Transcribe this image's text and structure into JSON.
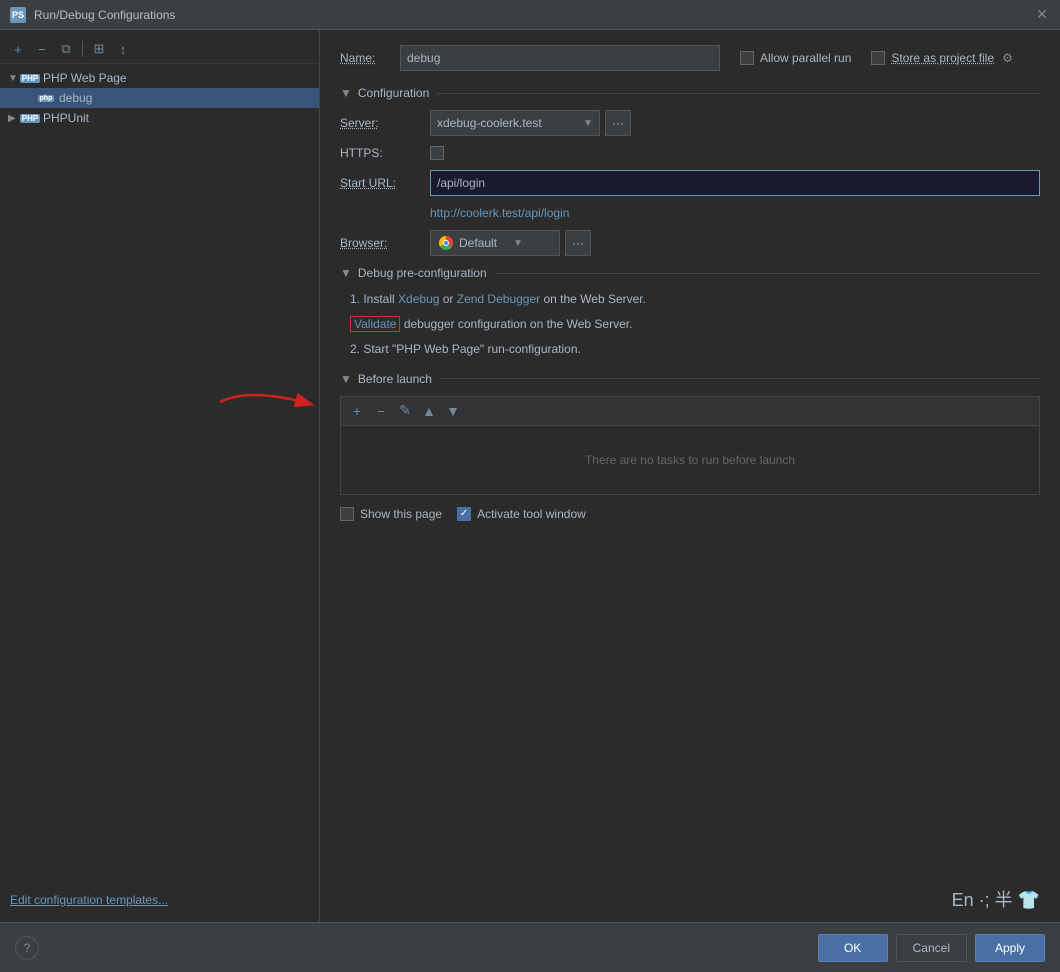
{
  "titleBar": {
    "title": "Run/Debug Configurations",
    "closeIcon": "✕"
  },
  "toolbar": {
    "addBtn": "+",
    "removeBtn": "−",
    "copyBtn": "⧉",
    "moveBtn": "⊞",
    "sortBtn": "↕"
  },
  "sidebar": {
    "groups": [
      {
        "name": "PHP Web Page",
        "icon": "PS",
        "expanded": true,
        "children": [
          {
            "name": "debug",
            "icon": "php"
          }
        ]
      },
      {
        "name": "PHPUnit",
        "icon": "PS",
        "expanded": false,
        "children": []
      }
    ]
  },
  "configPanel": {
    "nameLabel": "Name:",
    "nameValue": "debug",
    "allowParallelLabel": "Allow parallel run",
    "storeAsProjectLabel": "Store as project file",
    "configSectionTitle": "Configuration",
    "serverLabel": "Server:",
    "serverValue": "xdebug-coolerk.test",
    "httpsLabel": "HTTPS:",
    "startUrlLabel": "Start URL:",
    "startUrlValue": "/api/login",
    "resolvedUrl": "http://coolerk.test/api/login",
    "browserLabel": "Browser:",
    "browserValue": "Default",
    "debugPreConfigTitle": "Debug pre-configuration",
    "debugStep1a": "1. Install ",
    "debugStep1b": "Xdebug",
    "debugStep1c": " or ",
    "debugStep1d": "Zend Debugger",
    "debugStep1e": " on the Web Server.",
    "validateLabel": "Validate",
    "debugStep2a": " debugger configuration on the Web Server.",
    "debugStep3": "2. Start \"PHP Web Page\" run-configuration.",
    "beforeLaunchTitle": "Before launch",
    "beforeLaunchEmpty": "There are no tasks to run before launch",
    "showThisPageLabel": "Show this page",
    "activateToolWindowLabel": "Activate tool window",
    "editConfigLink": "Edit configuration templates...",
    "okLabel": "OK",
    "cancelLabel": "Cancel",
    "applyLabel": "Apply",
    "helpIcon": "?",
    "systemTray": "En ·; 半 👕"
  }
}
